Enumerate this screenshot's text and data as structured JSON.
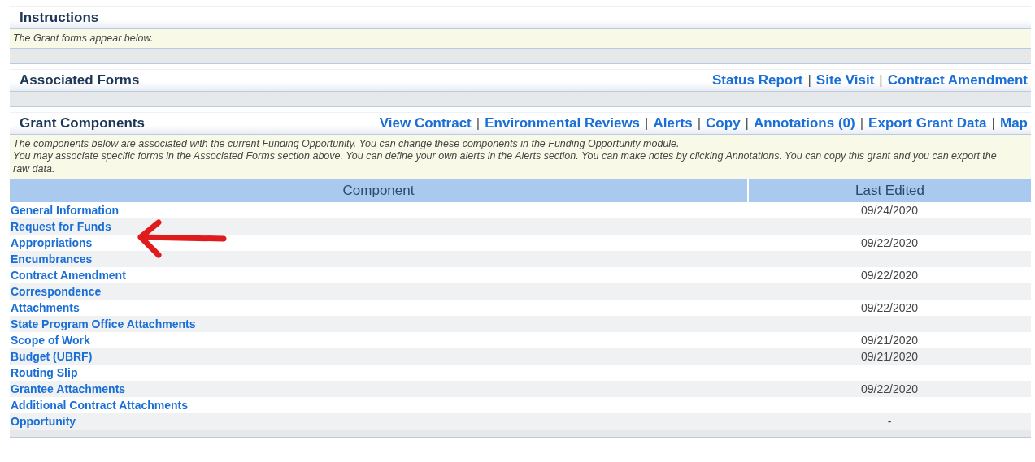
{
  "instructions": {
    "title": "Instructions",
    "note": "The Grant forms appear below."
  },
  "associated_forms": {
    "title": "Associated Forms",
    "separator": "|",
    "links": [
      "Status Report",
      "Site Visit",
      "Contract Amendment"
    ]
  },
  "grant_components": {
    "title": "Grant Components",
    "separator": "|",
    "links": [
      "View Contract",
      "Environmental Reviews",
      "Alerts",
      "Copy",
      "Annotations (0)",
      "Export Grant Data",
      "Map"
    ],
    "description": [
      "The components below are associated with the current Funding Opportunity. You can change these components in the Funding Opportunity module.",
      "You may associate specific forms in the Associated Forms section above. You can define your own alerts in the Alerts section. You can make notes by clicking Annotations. You can copy this grant and you can export the raw data."
    ],
    "table": {
      "columns": [
        "Component",
        "Last Edited"
      ],
      "rows": [
        {
          "component": "General Information",
          "last_edited": "09/24/2020"
        },
        {
          "component": "Request for Funds"
        },
        {
          "component": "Appropriations",
          "last_edited": "09/22/2020"
        },
        {
          "component": "Encumbrances"
        },
        {
          "component": "Contract Amendment",
          "last_edited": "09/22/2020"
        },
        {
          "component": "Correspondence"
        },
        {
          "component": "Attachments",
          "last_edited": "09/22/2020"
        },
        {
          "component": "State Program Office Attachments"
        },
        {
          "component": "Scope of Work",
          "last_edited": "09/21/2020"
        },
        {
          "component": "Budget (UBRF)",
          "last_edited": "09/21/2020"
        },
        {
          "component": "Routing Slip"
        },
        {
          "component": "Grantee Attachments",
          "last_edited": "09/22/2020"
        },
        {
          "component": "Additional Contract Attachments"
        },
        {
          "component": "Opportunity",
          "last_edited": "-"
        }
      ]
    }
  }
}
